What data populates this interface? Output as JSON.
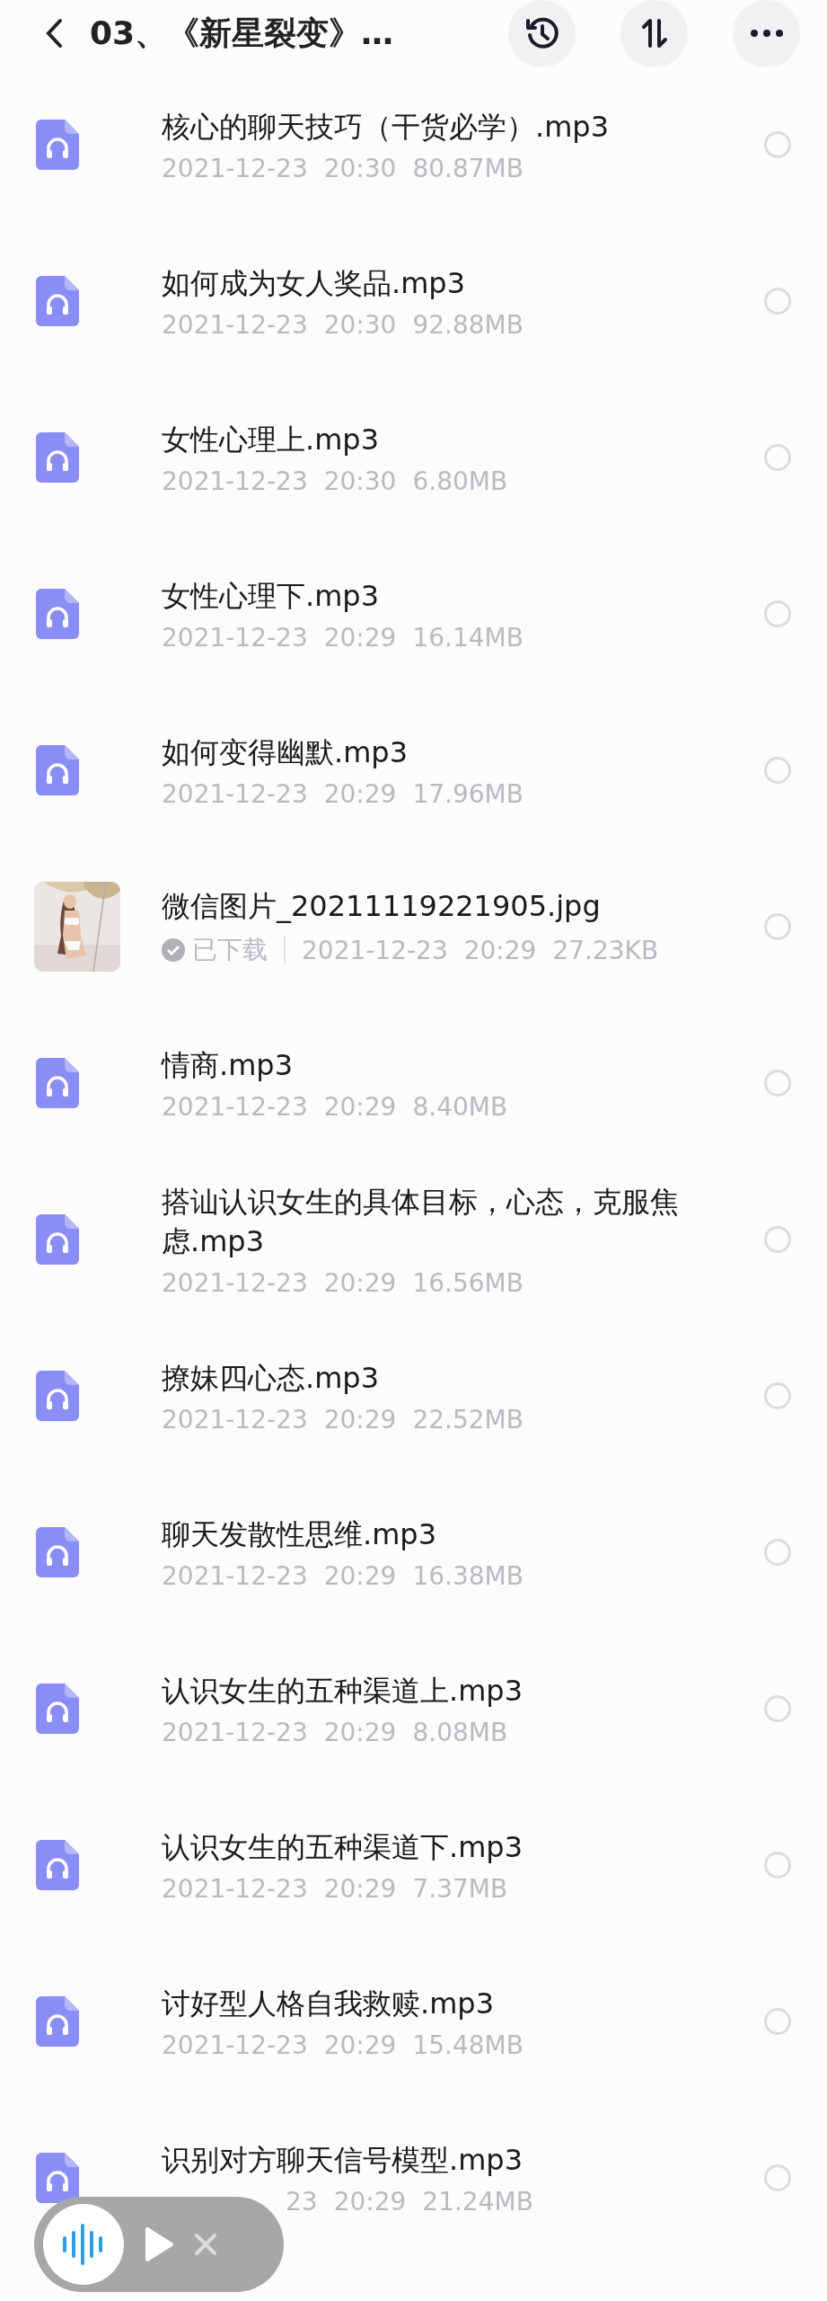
{
  "header": {
    "title": "03、《新星裂变》…"
  },
  "files": [
    {
      "kind": "audio",
      "title": "核心的聊天技巧（干货必学）.mp3",
      "downloaded": false,
      "date": "2021-12-23",
      "time": "20:30",
      "size": "80.87MB",
      "selected": false
    },
    {
      "kind": "audio",
      "title": "如何成为女人奖品.mp3",
      "downloaded": false,
      "date": "2021-12-23",
      "time": "20:30",
      "size": "92.88MB",
      "selected": false
    },
    {
      "kind": "audio",
      "title": "女性心理上.mp3",
      "downloaded": false,
      "date": "2021-12-23",
      "time": "20:30",
      "size": "6.80MB",
      "selected": false
    },
    {
      "kind": "audio",
      "title": "女性心理下.mp3",
      "downloaded": false,
      "date": "2021-12-23",
      "time": "20:29",
      "size": "16.14MB",
      "selected": false
    },
    {
      "kind": "audio",
      "title": "如何变得幽默.mp3",
      "downloaded": false,
      "date": "2021-12-23",
      "time": "20:29",
      "size": "17.96MB",
      "selected": false
    },
    {
      "kind": "picture",
      "title": "微信图片_20211119221905.jpg",
      "downloaded": true,
      "downloaded_label": "已下载",
      "date": "2021-12-23",
      "time": "20:29",
      "size": "27.23KB",
      "selected": false
    },
    {
      "kind": "audio",
      "title": "情商.mp3",
      "downloaded": false,
      "date": "2021-12-23",
      "time": "20:29",
      "size": "8.40MB",
      "selected": false
    },
    {
      "kind": "audio",
      "title": "搭讪认识女生的具体目标，心态，克服焦虑.mp3",
      "downloaded": false,
      "date": "2021-12-23",
      "time": "20:29",
      "size": "16.56MB",
      "selected": false
    },
    {
      "kind": "audio",
      "title": "撩妹四心态.mp3",
      "downloaded": false,
      "date": "2021-12-23",
      "time": "20:29",
      "size": "22.52MB",
      "selected": false
    },
    {
      "kind": "audio",
      "title": "聊天发散性思维.mp3",
      "downloaded": false,
      "date": "2021-12-23",
      "time": "20:29",
      "size": "16.38MB",
      "selected": false
    },
    {
      "kind": "audio",
      "title": "认识女生的五种渠道上.mp3",
      "downloaded": false,
      "date": "2021-12-23",
      "time": "20:29",
      "size": "8.08MB",
      "selected": false
    },
    {
      "kind": "audio",
      "title": "认识女生的五种渠道下.mp3",
      "downloaded": false,
      "date": "2021-12-23",
      "time": "20:29",
      "size": "7.37MB",
      "selected": false
    },
    {
      "kind": "audio",
      "title": "讨好型人格自我救赎.mp3",
      "downloaded": false,
      "date": "2021-12-23",
      "time": "20:29",
      "size": "15.48MB",
      "selected": false
    },
    {
      "kind": "audio",
      "title": "识别对方聊天信号模型.mp3",
      "downloaded": false,
      "date": "23",
      "date_cut": true,
      "time": "20:29",
      "size": "21.24MB",
      "selected": false
    }
  ]
}
